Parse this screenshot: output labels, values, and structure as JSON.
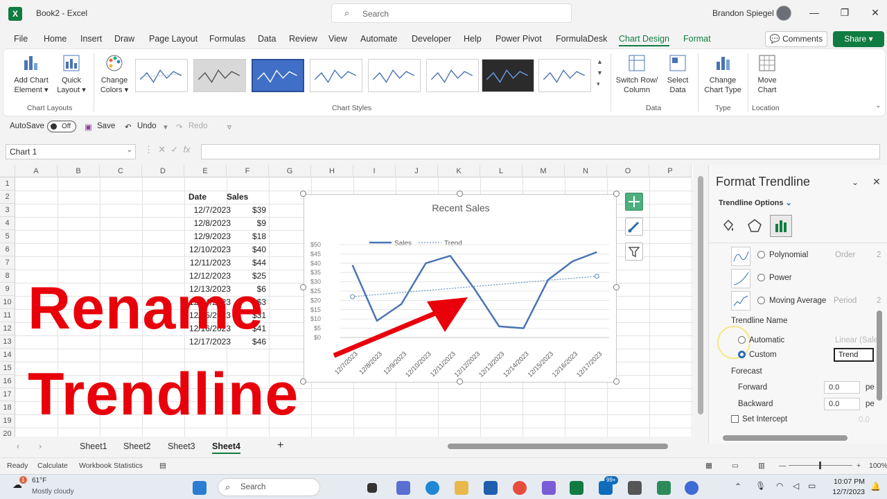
{
  "window": {
    "title": "Book2  -  Excel",
    "app_icon_letter": "X",
    "search_placeholder": "Search",
    "user": "Brandon Spiegel"
  },
  "menu": [
    "File",
    "Home",
    "Insert",
    "Draw",
    "Page Layout",
    "Formulas",
    "Data",
    "Review",
    "View",
    "Automate",
    "Developer",
    "Help",
    "Power Pivot",
    "FormulaDesk",
    "Chart Design",
    "Format"
  ],
  "menu_active": "Chart Design",
  "buttons": {
    "comments": "Comments",
    "share": "Share"
  },
  "ribbon": {
    "add_chart_element": [
      "Add Chart",
      "Element"
    ],
    "quick_layout": [
      "Quick",
      "Layout"
    ],
    "change_colors": [
      "Change",
      "Colors"
    ],
    "switch_row_col": [
      "Switch Row/",
      "Column"
    ],
    "select_data": [
      "Select",
      "Data"
    ],
    "change_chart_type": [
      "Change",
      "Chart Type"
    ],
    "move_chart": [
      "Move",
      "Chart"
    ],
    "groups": {
      "chart_layouts": "Chart Layouts",
      "chart_styles": "Chart Styles",
      "data": "Data",
      "type": "Type",
      "location": "Location"
    }
  },
  "qat": {
    "autosave": "AutoSave",
    "autosave_state": "Off",
    "save": "Save",
    "undo": "Undo",
    "redo": "Redo"
  },
  "formula_bar": {
    "name_box": "Chart 1",
    "fx": "fx"
  },
  "columns": [
    "A",
    "B",
    "C",
    "D",
    "E",
    "F",
    "G",
    "H",
    "I",
    "J",
    "K",
    "L",
    "M",
    "N",
    "O",
    "P"
  ],
  "rows": [
    "1",
    "2",
    "3",
    "4",
    "5",
    "6",
    "7",
    "8",
    "9",
    "10",
    "11",
    "12",
    "13",
    "14",
    "15",
    "16",
    "17",
    "18",
    "19",
    "20"
  ],
  "table": {
    "header_date": "Date",
    "header_sales": "Sales",
    "dates": [
      "12/7/2023",
      "12/8/2023",
      "12/9/2023",
      "12/10/2023",
      "12/11/2023",
      "12/12/2023",
      "12/13/2023",
      "12/14/2023",
      "12/15/2023",
      "12/16/2023",
      "12/17/2023"
    ],
    "sales": [
      "$39",
      "$9",
      "$18",
      "$40",
      "$44",
      "$25",
      "$6",
      "$3",
      "$31",
      "$41",
      "$46"
    ]
  },
  "chart_data": {
    "type": "line",
    "title": "Recent Sales",
    "categories": [
      "12/7/2023",
      "12/8/2023",
      "12/9/2023",
      "12/10/2023",
      "12/11/2023",
      "12/12/2023",
      "12/13/2023",
      "12/14/2023",
      "12/15/2023",
      "12/16/2023",
      "12/17/2023"
    ],
    "series": [
      {
        "name": "Sales",
        "values": [
          39,
          9,
          18,
          40,
          44,
          26,
          6,
          5,
          31,
          41,
          46
        ]
      },
      {
        "name": "Trend",
        "values": [
          22,
          23.1,
          24.2,
          25.3,
          26.4,
          27.5,
          28.6,
          29.7,
          30.8,
          31.9,
          33
        ]
      }
    ],
    "y_ticks": [
      "$0",
      "$5",
      "$10",
      "$15",
      "$20",
      "$25",
      "$30",
      "$35",
      "$40",
      "$45",
      "$50"
    ],
    "ylim": [
      0,
      50
    ],
    "legend_position": "top",
    "colors": {
      "sales": "#4a74b4",
      "trend": "#6f95c9"
    }
  },
  "overlay": {
    "line1": "Rename",
    "line2": "Trendline"
  },
  "pane": {
    "title": "Format Trendline",
    "options_label": "Trendline Options",
    "polynomial": "Polynomial",
    "order_label": "Order",
    "order_value": "2",
    "power": "Power",
    "moving_average": "Moving Average",
    "period_label": "Period",
    "period_value": "2",
    "trendline_name_label": "Trendline Name",
    "automatic": "Automatic",
    "automatic_value": "Linear (Sale",
    "custom": "Custom",
    "custom_value": "Trend",
    "forecast_label": "Forecast",
    "forward": "Forward",
    "forward_value": "0.0",
    "backward": "Backward",
    "backward_value": "0.0",
    "unit": "pe",
    "set_intercept": "Set Intercept",
    "intercept_value": "0.0"
  },
  "sheets": [
    "Sheet1",
    "Sheet2",
    "Sheet3",
    "Sheet4"
  ],
  "active_sheet": "Sheet4",
  "status": {
    "ready": "Ready",
    "calculate": "Calculate",
    "workbook_stats": "Workbook Statistics",
    "zoom": "100%"
  },
  "taskbar": {
    "weather_temp": "61°F",
    "weather_desc": "Mostly cloudy",
    "search": "Search",
    "time": "10:07 PM",
    "date": "12/7/2023",
    "badge1": "1",
    "badge2": "99+"
  }
}
